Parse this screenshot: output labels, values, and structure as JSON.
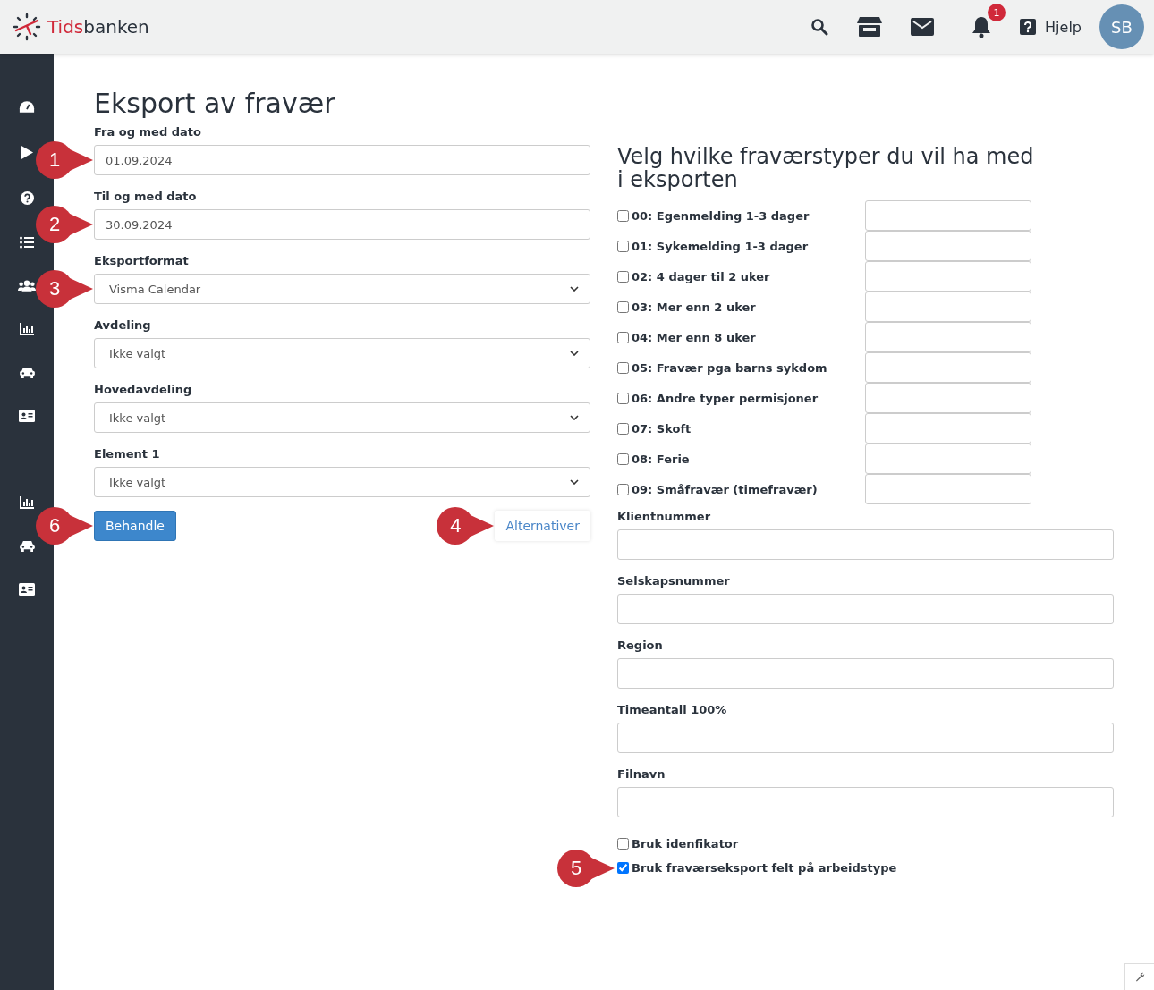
{
  "header": {
    "logo": {
      "accent": "Tids",
      "rest": "banken"
    },
    "notifications_badge": "1",
    "help_label": "Hjelp",
    "avatar_initials": "SB"
  },
  "page_title": "Eksport av fravær",
  "left_fields": [
    {
      "kind": "input",
      "label": "Fra og med dato",
      "value": "01.09.2024",
      "callout": "1"
    },
    {
      "kind": "input",
      "label": "Til og med dato",
      "value": "30.09.2024",
      "callout": "2"
    },
    {
      "kind": "select",
      "label": "Eksportformat",
      "value": "Visma Calendar",
      "callout": "3"
    },
    {
      "kind": "select",
      "label": "Avdeling",
      "value": "Ikke valgt"
    },
    {
      "kind": "select",
      "label": "Hovedavdeling",
      "value": "Ikke valgt"
    },
    {
      "kind": "select",
      "label": "Element 1",
      "value": "Ikke valgt"
    }
  ],
  "actions": {
    "process": {
      "label": "Behandle",
      "callout": "6"
    },
    "options": {
      "label": "Alternativer",
      "callout": "4"
    }
  },
  "right_heading": "Velg hvilke fraværstyper du vil ha med i eksporten",
  "absence_types": [
    {
      "label": "00: Egenmelding 1-3 dager",
      "checked": false
    },
    {
      "label": "01: Sykemelding 1-3 dager",
      "checked": false
    },
    {
      "label": "02: 4 dager til 2 uker",
      "checked": false
    },
    {
      "label": "03: Mer enn 2 uker",
      "checked": false
    },
    {
      "label": "04: Mer enn 8 uker",
      "checked": false
    },
    {
      "label": "05: Fravær pga barns sykdom",
      "checked": false
    },
    {
      "label": "06: Andre typer permisjoner",
      "checked": false
    },
    {
      "label": "07: Skoft",
      "checked": false
    },
    {
      "label": "08: Ferie",
      "checked": false
    },
    {
      "label": "09: Småfravær (timefravær)",
      "checked": false
    }
  ],
  "right_fields": [
    {
      "label": "Klientnummer"
    },
    {
      "label": "Selskapsnummer"
    },
    {
      "label": "Region"
    },
    {
      "label": "Timeantall 100%"
    },
    {
      "label": "Filnavn"
    }
  ],
  "bottom_options": [
    {
      "label": "Bruk idenfikator",
      "checked": false
    },
    {
      "label": "Bruk fraværseksport felt på arbeidstype",
      "checked": true,
      "callout": "5"
    }
  ]
}
